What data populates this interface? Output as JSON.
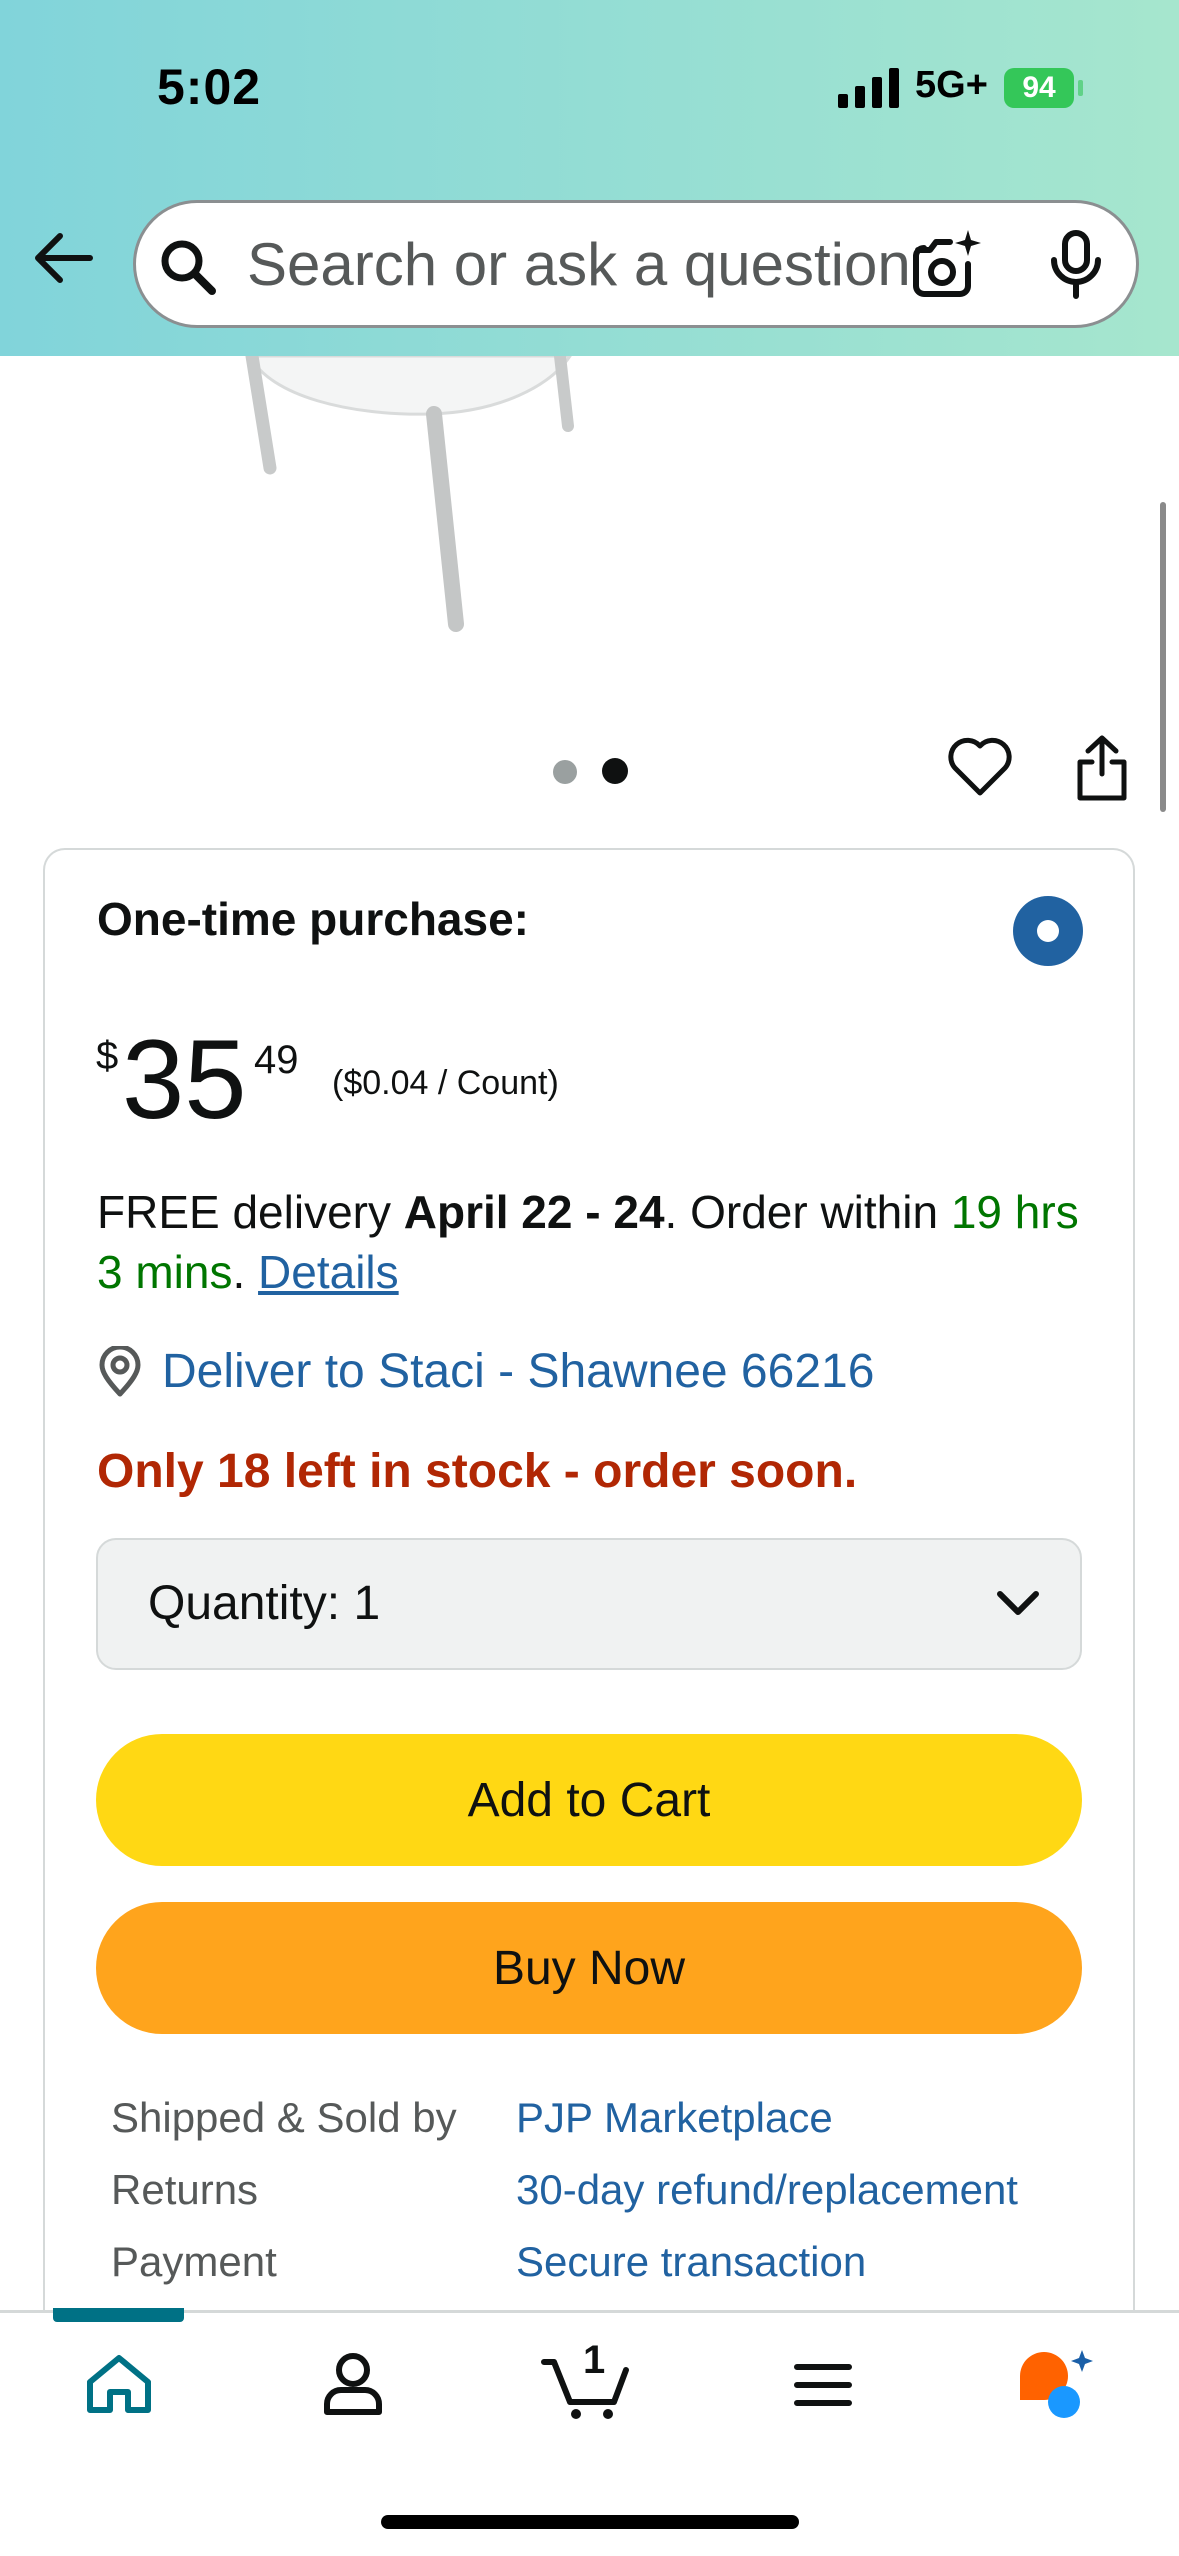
{
  "status_bar": {
    "time": "5:02",
    "network": "5G+",
    "battery": "94"
  },
  "search": {
    "placeholder": "Search or ask a question"
  },
  "product_images": {
    "total": 2,
    "current": 2
  },
  "buy_box": {
    "purchase_type": "One-time purchase:",
    "price_symbol": "$",
    "price_whole": "35",
    "price_fraction": "49",
    "unit_price": "($0.04 / Count)",
    "delivery_prefix": "FREE delivery ",
    "delivery_dates": "April 22 - 24",
    "delivery_mid": ". Order within ",
    "delivery_countdown": "19 hrs 3 mins",
    "delivery_sep": ". ",
    "details_link": "Details",
    "deliver_to": "Deliver to Staci - Shawnee 66216",
    "stock_message": "Only 18 left in stock - order soon.",
    "quantity_label": "Quantity:",
    "quantity_value": "1",
    "add_to_cart": "Add to Cart",
    "buy_now": "Buy Now",
    "info": [
      {
        "label": "Shipped & Sold by",
        "value": "PJP Marketplace"
      },
      {
        "label": "Returns",
        "value": "30-day refund/replacement"
      },
      {
        "label": "Payment",
        "value": "Secure transaction"
      }
    ]
  },
  "bottom_nav": {
    "cart_count": "1",
    "active": "home"
  },
  "colors": {
    "add_to_cart": "#ffd814",
    "buy_now": "#ffa41c",
    "link": "#2162a1",
    "stock_red": "#b12704",
    "countdown_green": "#007600"
  }
}
